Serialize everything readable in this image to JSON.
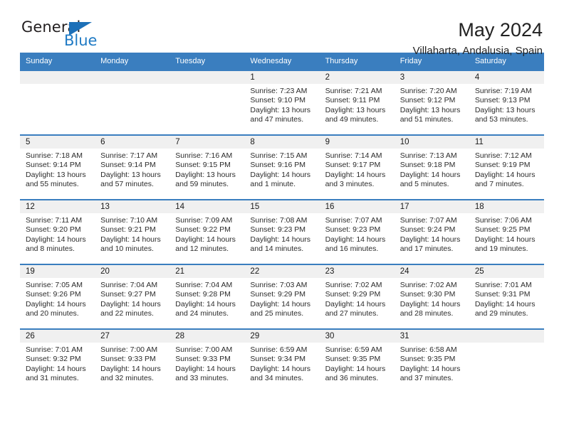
{
  "brand": {
    "name_top": "General",
    "name_bottom": "Blue",
    "triangle_color": "#1d70b8",
    "blue_color": "#1f7ac4"
  },
  "header": {
    "month_title": "May 2024",
    "location": "Villaharta, Andalusia, Spain"
  },
  "theme": {
    "header_blue": "#3a7ebf",
    "daynum_bg": "#f0f0f0",
    "text": "#2b2b2b"
  },
  "weekdays": [
    "Sunday",
    "Monday",
    "Tuesday",
    "Wednesday",
    "Thursday",
    "Friday",
    "Saturday"
  ],
  "labels": {
    "sunrise": "Sunrise:",
    "sunset": "Sunset:",
    "daylight": "Daylight:"
  },
  "weeks": [
    [
      {
        "day": "",
        "empty": true
      },
      {
        "day": "",
        "empty": true
      },
      {
        "day": "",
        "empty": true
      },
      {
        "day": "1",
        "sunrise": "Sunrise: 7:23 AM",
        "sunset": "Sunset: 9:10 PM",
        "daylight1": "Daylight: 13 hours",
        "daylight2": "and 47 minutes."
      },
      {
        "day": "2",
        "sunrise": "Sunrise: 7:21 AM",
        "sunset": "Sunset: 9:11 PM",
        "daylight1": "Daylight: 13 hours",
        "daylight2": "and 49 minutes."
      },
      {
        "day": "3",
        "sunrise": "Sunrise: 7:20 AM",
        "sunset": "Sunset: 9:12 PM",
        "daylight1": "Daylight: 13 hours",
        "daylight2": "and 51 minutes."
      },
      {
        "day": "4",
        "sunrise": "Sunrise: 7:19 AM",
        "sunset": "Sunset: 9:13 PM",
        "daylight1": "Daylight: 13 hours",
        "daylight2": "and 53 minutes."
      }
    ],
    [
      {
        "day": "5",
        "sunrise": "Sunrise: 7:18 AM",
        "sunset": "Sunset: 9:14 PM",
        "daylight1": "Daylight: 13 hours",
        "daylight2": "and 55 minutes."
      },
      {
        "day": "6",
        "sunrise": "Sunrise: 7:17 AM",
        "sunset": "Sunset: 9:14 PM",
        "daylight1": "Daylight: 13 hours",
        "daylight2": "and 57 minutes."
      },
      {
        "day": "7",
        "sunrise": "Sunrise: 7:16 AM",
        "sunset": "Sunset: 9:15 PM",
        "daylight1": "Daylight: 13 hours",
        "daylight2": "and 59 minutes."
      },
      {
        "day": "8",
        "sunrise": "Sunrise: 7:15 AM",
        "sunset": "Sunset: 9:16 PM",
        "daylight1": "Daylight: 14 hours",
        "daylight2": "and 1 minute."
      },
      {
        "day": "9",
        "sunrise": "Sunrise: 7:14 AM",
        "sunset": "Sunset: 9:17 PM",
        "daylight1": "Daylight: 14 hours",
        "daylight2": "and 3 minutes."
      },
      {
        "day": "10",
        "sunrise": "Sunrise: 7:13 AM",
        "sunset": "Sunset: 9:18 PM",
        "daylight1": "Daylight: 14 hours",
        "daylight2": "and 5 minutes."
      },
      {
        "day": "11",
        "sunrise": "Sunrise: 7:12 AM",
        "sunset": "Sunset: 9:19 PM",
        "daylight1": "Daylight: 14 hours",
        "daylight2": "and 7 minutes."
      }
    ],
    [
      {
        "day": "12",
        "sunrise": "Sunrise: 7:11 AM",
        "sunset": "Sunset: 9:20 PM",
        "daylight1": "Daylight: 14 hours",
        "daylight2": "and 8 minutes."
      },
      {
        "day": "13",
        "sunrise": "Sunrise: 7:10 AM",
        "sunset": "Sunset: 9:21 PM",
        "daylight1": "Daylight: 14 hours",
        "daylight2": "and 10 minutes."
      },
      {
        "day": "14",
        "sunrise": "Sunrise: 7:09 AM",
        "sunset": "Sunset: 9:22 PM",
        "daylight1": "Daylight: 14 hours",
        "daylight2": "and 12 minutes."
      },
      {
        "day": "15",
        "sunrise": "Sunrise: 7:08 AM",
        "sunset": "Sunset: 9:23 PM",
        "daylight1": "Daylight: 14 hours",
        "daylight2": "and 14 minutes."
      },
      {
        "day": "16",
        "sunrise": "Sunrise: 7:07 AM",
        "sunset": "Sunset: 9:23 PM",
        "daylight1": "Daylight: 14 hours",
        "daylight2": "and 16 minutes."
      },
      {
        "day": "17",
        "sunrise": "Sunrise: 7:07 AM",
        "sunset": "Sunset: 9:24 PM",
        "daylight1": "Daylight: 14 hours",
        "daylight2": "and 17 minutes."
      },
      {
        "day": "18",
        "sunrise": "Sunrise: 7:06 AM",
        "sunset": "Sunset: 9:25 PM",
        "daylight1": "Daylight: 14 hours",
        "daylight2": "and 19 minutes."
      }
    ],
    [
      {
        "day": "19",
        "sunrise": "Sunrise: 7:05 AM",
        "sunset": "Sunset: 9:26 PM",
        "daylight1": "Daylight: 14 hours",
        "daylight2": "and 20 minutes."
      },
      {
        "day": "20",
        "sunrise": "Sunrise: 7:04 AM",
        "sunset": "Sunset: 9:27 PM",
        "daylight1": "Daylight: 14 hours",
        "daylight2": "and 22 minutes."
      },
      {
        "day": "21",
        "sunrise": "Sunrise: 7:04 AM",
        "sunset": "Sunset: 9:28 PM",
        "daylight1": "Daylight: 14 hours",
        "daylight2": "and 24 minutes."
      },
      {
        "day": "22",
        "sunrise": "Sunrise: 7:03 AM",
        "sunset": "Sunset: 9:29 PM",
        "daylight1": "Daylight: 14 hours",
        "daylight2": "and 25 minutes."
      },
      {
        "day": "23",
        "sunrise": "Sunrise: 7:02 AM",
        "sunset": "Sunset: 9:29 PM",
        "daylight1": "Daylight: 14 hours",
        "daylight2": "and 27 minutes."
      },
      {
        "day": "24",
        "sunrise": "Sunrise: 7:02 AM",
        "sunset": "Sunset: 9:30 PM",
        "daylight1": "Daylight: 14 hours",
        "daylight2": "and 28 minutes."
      },
      {
        "day": "25",
        "sunrise": "Sunrise: 7:01 AM",
        "sunset": "Sunset: 9:31 PM",
        "daylight1": "Daylight: 14 hours",
        "daylight2": "and 29 minutes."
      }
    ],
    [
      {
        "day": "26",
        "sunrise": "Sunrise: 7:01 AM",
        "sunset": "Sunset: 9:32 PM",
        "daylight1": "Daylight: 14 hours",
        "daylight2": "and 31 minutes."
      },
      {
        "day": "27",
        "sunrise": "Sunrise: 7:00 AM",
        "sunset": "Sunset: 9:33 PM",
        "daylight1": "Daylight: 14 hours",
        "daylight2": "and 32 minutes."
      },
      {
        "day": "28",
        "sunrise": "Sunrise: 7:00 AM",
        "sunset": "Sunset: 9:33 PM",
        "daylight1": "Daylight: 14 hours",
        "daylight2": "and 33 minutes."
      },
      {
        "day": "29",
        "sunrise": "Sunrise: 6:59 AM",
        "sunset": "Sunset: 9:34 PM",
        "daylight1": "Daylight: 14 hours",
        "daylight2": "and 34 minutes."
      },
      {
        "day": "30",
        "sunrise": "Sunrise: 6:59 AM",
        "sunset": "Sunset: 9:35 PM",
        "daylight1": "Daylight: 14 hours",
        "daylight2": "and 36 minutes."
      },
      {
        "day": "31",
        "sunrise": "Sunrise: 6:58 AM",
        "sunset": "Sunset: 9:35 PM",
        "daylight1": "Daylight: 14 hours",
        "daylight2": "and 37 minutes."
      },
      {
        "day": "",
        "empty": true
      }
    ]
  ]
}
